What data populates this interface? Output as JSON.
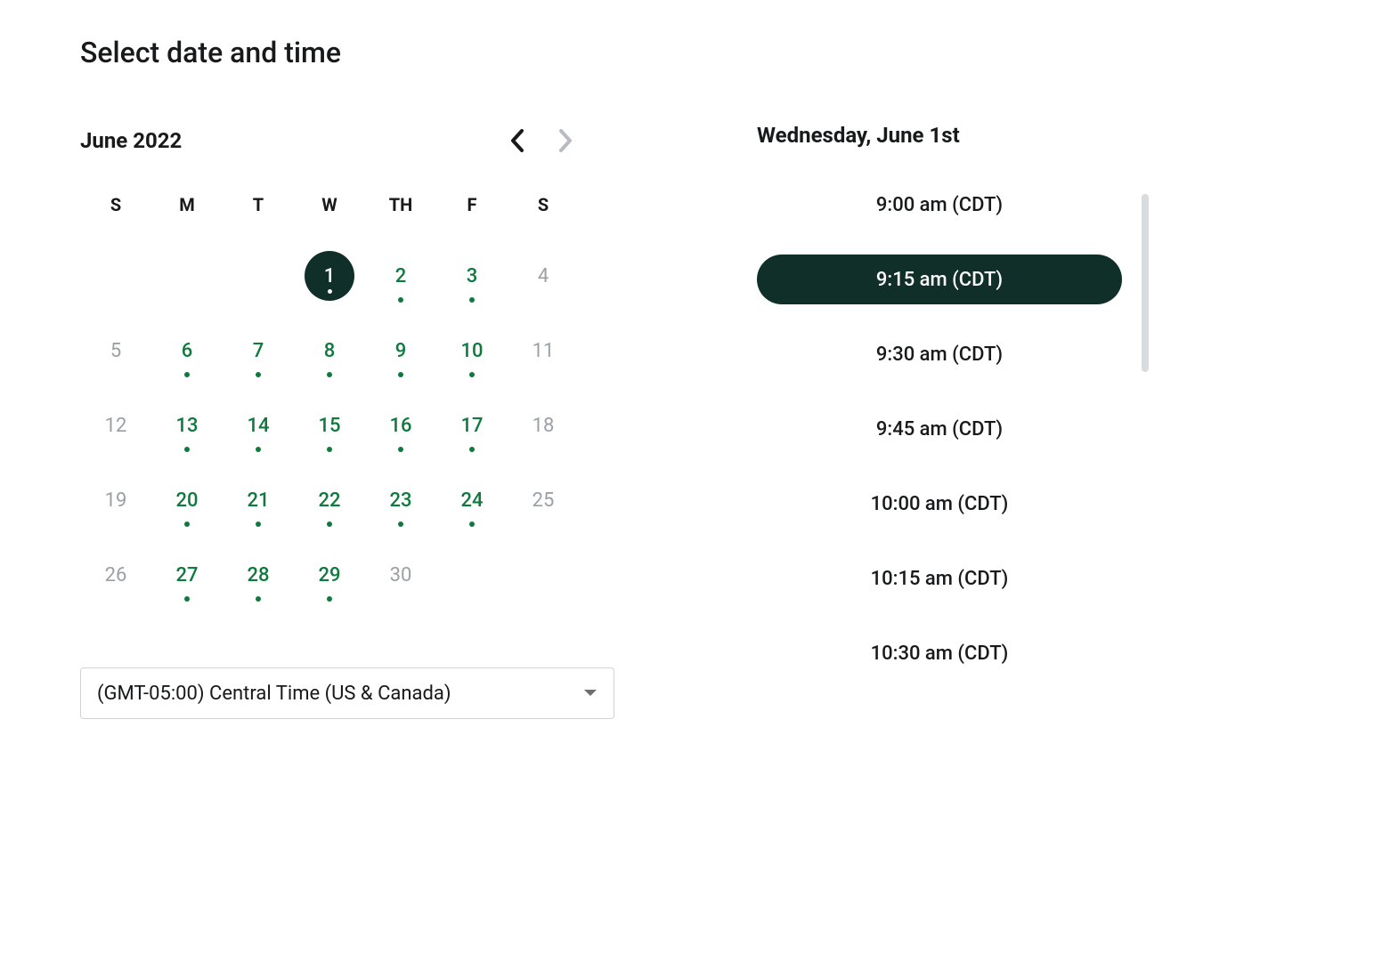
{
  "title": "Select date and time",
  "calendar": {
    "month_label": "June 2022",
    "dow": [
      "S",
      "M",
      "T",
      "W",
      "TH",
      "F",
      "S"
    ],
    "days": [
      {
        "n": "",
        "state": "empty"
      },
      {
        "n": "",
        "state": "empty"
      },
      {
        "n": "",
        "state": "empty"
      },
      {
        "n": "1",
        "state": "selected"
      },
      {
        "n": "2",
        "state": "available"
      },
      {
        "n": "3",
        "state": "available"
      },
      {
        "n": "4",
        "state": "disabled"
      },
      {
        "n": "5",
        "state": "disabled"
      },
      {
        "n": "6",
        "state": "available"
      },
      {
        "n": "7",
        "state": "available"
      },
      {
        "n": "8",
        "state": "available"
      },
      {
        "n": "9",
        "state": "available"
      },
      {
        "n": "10",
        "state": "available"
      },
      {
        "n": "11",
        "state": "disabled"
      },
      {
        "n": "12",
        "state": "disabled"
      },
      {
        "n": "13",
        "state": "available"
      },
      {
        "n": "14",
        "state": "available"
      },
      {
        "n": "15",
        "state": "available"
      },
      {
        "n": "16",
        "state": "available"
      },
      {
        "n": "17",
        "state": "available"
      },
      {
        "n": "18",
        "state": "disabled"
      },
      {
        "n": "19",
        "state": "disabled"
      },
      {
        "n": "20",
        "state": "available"
      },
      {
        "n": "21",
        "state": "available"
      },
      {
        "n": "22",
        "state": "available"
      },
      {
        "n": "23",
        "state": "available"
      },
      {
        "n": "24",
        "state": "available"
      },
      {
        "n": "25",
        "state": "disabled"
      },
      {
        "n": "26",
        "state": "disabled"
      },
      {
        "n": "27",
        "state": "available"
      },
      {
        "n": "28",
        "state": "available"
      },
      {
        "n": "29",
        "state": "available"
      },
      {
        "n": "30",
        "state": "disabled"
      },
      {
        "n": "",
        "state": "empty"
      },
      {
        "n": "",
        "state": "empty"
      }
    ]
  },
  "timezone": {
    "selected": "(GMT-05:00) Central Time (US & Canada)"
  },
  "times": {
    "header": "Wednesday, June 1st",
    "slots": [
      {
        "label": "9:00 am (CDT)",
        "selected": false
      },
      {
        "label": "9:15 am (CDT)",
        "selected": true
      },
      {
        "label": "9:30 am (CDT)",
        "selected": false
      },
      {
        "label": "9:45 am (CDT)",
        "selected": false
      },
      {
        "label": "10:00 am (CDT)",
        "selected": false
      },
      {
        "label": "10:15 am (CDT)",
        "selected": false
      },
      {
        "label": "10:30 am (CDT)",
        "selected": false
      }
    ]
  }
}
